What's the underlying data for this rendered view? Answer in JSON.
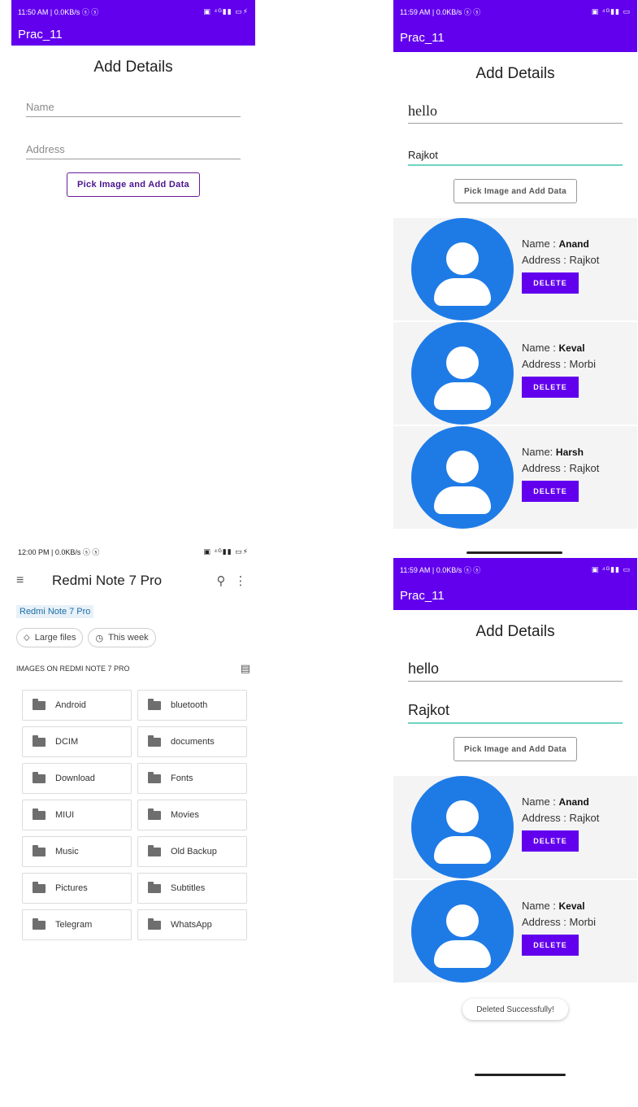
{
  "panel1": {
    "status_time": "11:50 AM | 0.0KB/s ⓢ ⓢ",
    "status_right": "▣ ⁴ᴳ▮▮ ▭⚡",
    "app_title": "Prac_11",
    "form_title": "Add Details",
    "name_placeholder": "Name",
    "address_placeholder": "Address",
    "pick_button": "Pick Image and Add Data"
  },
  "panel2": {
    "status_time": "11:59 AM | 0.0KB/s ⓢ ⓢ",
    "status_right": "▣ ⁴ᴳ▮▮ ▭",
    "app_title": "Prac_11",
    "form_title": "Add Details",
    "name_value": "hello",
    "address_value": "Rajkot",
    "pick_button": "Pick Image and Add Data",
    "cards": [
      {
        "name_label": "Name : ",
        "name": "Anand",
        "address_label": "Address : ",
        "address": "Rajkot",
        "delete": "DELETE"
      },
      {
        "name_label": "Name : ",
        "name": "Keval",
        "address_label": "Address : ",
        "address": "Morbi",
        "delete": "DELETE"
      },
      {
        "name_label": "Name: ",
        "name": "Harsh",
        "address_label": "Address : ",
        "address": "Rajkot",
        "delete": "DELETE"
      }
    ]
  },
  "panel3": {
    "status_time": "12:00 PM | 0.0KB/s ⓢ ⓢ",
    "status_right": "▣ ⁴ᴳ▮▮ ▭⚡",
    "title": "Redmi Note 7 Pro",
    "breadcrumb": "Redmi Note 7 Pro",
    "chips": [
      "Large files",
      "This week"
    ],
    "section_title": "IMAGES ON REDMI NOTE 7 PRO",
    "folders": [
      "Android",
      "bluetooth",
      "DCIM",
      "documents",
      "Download",
      "Fonts",
      "MIUI",
      "Movies",
      "Music",
      "Old Backup",
      "Pictures",
      "Subtitles",
      "Telegram",
      "WhatsApp"
    ]
  },
  "panel4": {
    "status_time": "11:59 AM | 0.0KB/s ⓢ ⓢ",
    "status_right": "▣ ⁴ᴳ▮▮ ▭",
    "app_title": "Prac_11",
    "form_title": "Add Details",
    "name_value": "hello",
    "address_value": "Rajkot",
    "pick_button": "Pick Image and Add Data",
    "cards": [
      {
        "name_label": "Name : ",
        "name": "Anand",
        "address_label": "Address : ",
        "address": "Rajkot",
        "delete": "DELETE"
      },
      {
        "name_label": "Name : ",
        "name": "Keval",
        "address_label": "Address : ",
        "address": "Morbi",
        "delete": "DELETE"
      }
    ],
    "toast": "Deleted Successfully!"
  },
  "colors": {
    "primary": "#6200ee",
    "avatar": "#1e7be6",
    "focus_underline": "#6fd3c0"
  }
}
